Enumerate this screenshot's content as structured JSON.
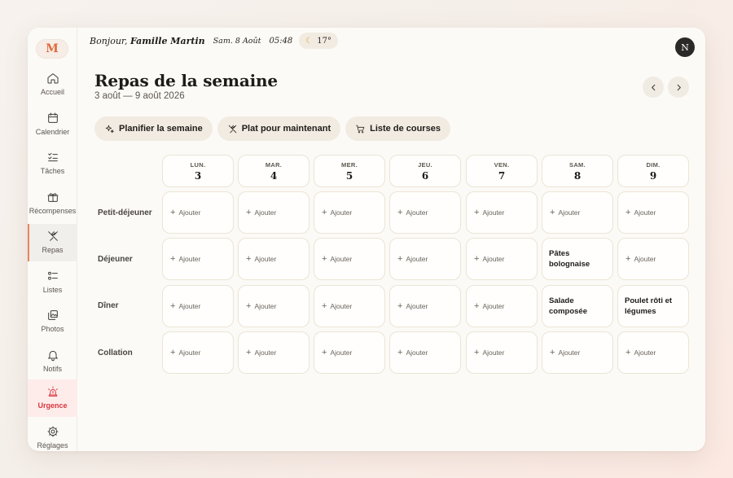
{
  "sidebar": {
    "logo": "M",
    "items": [
      {
        "label": "Accueil",
        "icon": "home-icon"
      },
      {
        "label": "Calendrier",
        "icon": "calendar-icon"
      },
      {
        "label": "Tâches",
        "icon": "checklist-icon"
      },
      {
        "label": "Récompenses",
        "icon": "gift-icon"
      },
      {
        "label": "Repas",
        "icon": "utensils-icon",
        "active": true
      },
      {
        "label": "Listes",
        "icon": "list-icon"
      },
      {
        "label": "Photos",
        "icon": "photos-icon"
      },
      {
        "label": "Notifs",
        "icon": "bell-icon"
      },
      {
        "label": "Urgence",
        "icon": "siren-icon",
        "urgent": true
      },
      {
        "label": "Réglages",
        "icon": "gear-icon"
      }
    ]
  },
  "header": {
    "greeting_prefix": "Bonjour, ",
    "family": "Famille Martin",
    "date": "Sam. 8 Août",
    "time": "05:48",
    "weather": "17°",
    "avatar": "N"
  },
  "page": {
    "title": "Repas de la semaine",
    "range": "3 août — 9 août 2026"
  },
  "actions": [
    {
      "label": "Planifier la semaine",
      "icon": "sparkle-icon"
    },
    {
      "label": "Plat pour maintenant",
      "icon": "utensils-icon"
    },
    {
      "label": "Liste de courses",
      "icon": "cart-icon"
    }
  ],
  "days": [
    {
      "name": "LUN.",
      "num": "3"
    },
    {
      "name": "MAR.",
      "num": "4"
    },
    {
      "name": "MER.",
      "num": "5"
    },
    {
      "name": "JEU.",
      "num": "6"
    },
    {
      "name": "VEN.",
      "num": "7"
    },
    {
      "name": "SAM.",
      "num": "8"
    },
    {
      "name": "DIM.",
      "num": "9"
    }
  ],
  "add_label": "Ajouter",
  "meals": [
    {
      "label": "Petit-déjeuner",
      "cells": [
        "",
        "",
        "",
        "",
        "",
        "",
        ""
      ]
    },
    {
      "label": "Déjeuner",
      "cells": [
        "",
        "",
        "",
        "",
        "",
        "Pâtes bolognaise",
        ""
      ]
    },
    {
      "label": "Dîner",
      "cells": [
        "",
        "",
        "",
        "",
        "",
        "Salade composée",
        "Poulet rôti et légumes"
      ]
    },
    {
      "label": "Collation",
      "cells": [
        "",
        "",
        "",
        "",
        "",
        "",
        ""
      ]
    }
  ],
  "colors": {
    "accent": "#e7865f",
    "urgent": "#d9363e",
    "surface": "#fcfaf6"
  }
}
